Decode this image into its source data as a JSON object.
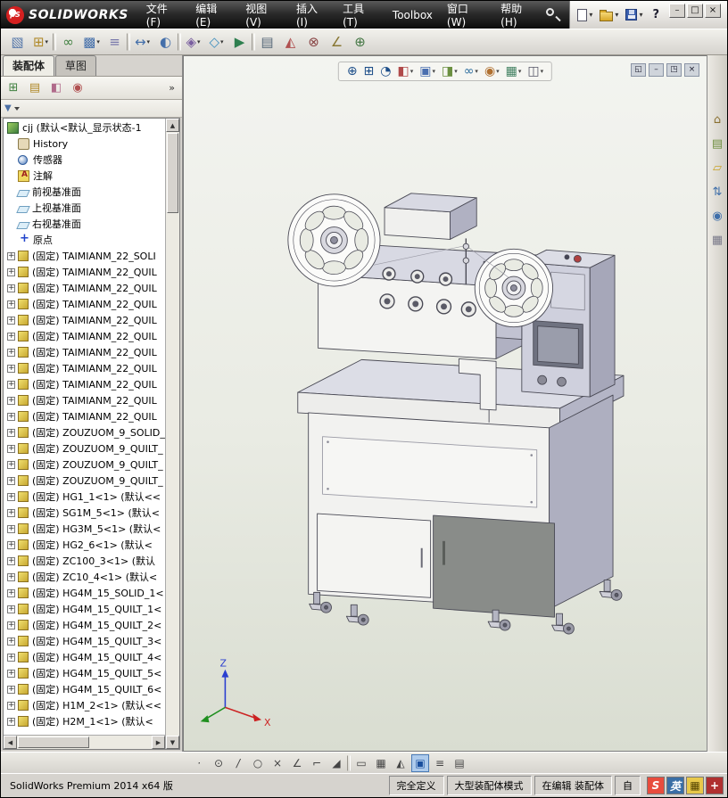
{
  "title_bar": {
    "logo_mark": "βS",
    "logo_text": "SOLIDWORKS",
    "menus": [
      "文件(F)",
      "编辑(E)",
      "视图(V)",
      "插入(I)",
      "工具(T)",
      "Toolbox",
      "窗口(W)",
      "帮助(H)"
    ],
    "quick_access": [
      {
        "name": "new-document-icon",
        "dropdown": true
      },
      {
        "name": "open-document-icon",
        "dropdown": true
      },
      {
        "name": "save-icon",
        "dropdown": true
      }
    ],
    "help_label": "?",
    "window_controls": [
      {
        "name": "minimize-button",
        "glyph": "–"
      },
      {
        "name": "maximize-button",
        "glyph": "□"
      },
      {
        "name": "close-button",
        "glyph": "×"
      }
    ]
  },
  "main_toolbar": {
    "items": [
      {
        "name": "edit-component-icon",
        "glyph": "▧",
        "color": "#5577aa"
      },
      {
        "name": "insert-components-icon",
        "glyph": "⊞",
        "color": "#b08a2a",
        "dropdown": true
      },
      {
        "type": "sep"
      },
      {
        "name": "mate-icon",
        "glyph": "∞",
        "color": "#3f7f3f"
      },
      {
        "name": "component-pattern-icon",
        "glyph": "▩",
        "color": "#446faa",
        "dropdown": true
      },
      {
        "name": "smart-fasteners-icon",
        "glyph": "≡",
        "color": "#7777aa"
      },
      {
        "type": "sep"
      },
      {
        "name": "move-component-icon",
        "glyph": "↔",
        "color": "#446faa",
        "dropdown": true
      },
      {
        "name": "show-hidden-components-icon",
        "glyph": "◐",
        "color": "#446faa"
      },
      {
        "type": "sep"
      },
      {
        "name": "assembly-features-icon",
        "glyph": "◈",
        "color": "#7a5fa0",
        "dropdown": true
      },
      {
        "name": "reference-geometry-icon",
        "glyph": "◇",
        "color": "#3f8fbf",
        "dropdown": true
      },
      {
        "name": "new-motion-study-icon",
        "glyph": "▶",
        "color": "#2e7f4f"
      },
      {
        "type": "sep"
      },
      {
        "name": "bill-of-materials-icon",
        "glyph": "▤",
        "color": "#556677"
      },
      {
        "name": "exploded-view-icon",
        "glyph": "◭",
        "color": "#b05050"
      },
      {
        "name": "interference-detection-icon",
        "glyph": "⊗",
        "color": "#884444"
      },
      {
        "name": "measure-icon",
        "glyph": "∠",
        "color": "#887733"
      },
      {
        "name": "mass-properties-icon",
        "glyph": "⊕",
        "color": "#447744"
      }
    ]
  },
  "left_panel": {
    "doc_tabs": [
      {
        "name": "tab-assembly",
        "label": "装配体",
        "active": true
      },
      {
        "name": "tab-sketch",
        "label": "草图",
        "active": false
      }
    ],
    "manager_tabs": [
      {
        "name": "featuremanager-tab-icon",
        "glyph": "⊞",
        "color": "#3f7f3f"
      },
      {
        "name": "propertymanager-tab-icon",
        "glyph": "▤",
        "color": "#b08a2a"
      },
      {
        "name": "configurationmanager-tab-icon",
        "glyph": "◧",
        "color": "#b06a8a"
      },
      {
        "name": "displaymanager-tab-icon",
        "glyph": "◉",
        "color": "#b05050"
      }
    ],
    "manager_more": "»",
    "filter": {
      "icon_glyph": "▼"
    },
    "tree": [
      {
        "type": "asm",
        "exp": "none",
        "label": "cjj (默认<默认_显示状态-1"
      },
      {
        "type": "history",
        "exp": "none",
        "label": "History"
      },
      {
        "type": "sensor",
        "exp": "none",
        "label": "传感器"
      },
      {
        "type": "ann",
        "exp": "none",
        "label": "注解"
      },
      {
        "type": "plane",
        "exp": "none",
        "label": "前视基准面"
      },
      {
        "type": "plane",
        "exp": "none",
        "label": "上视基准面"
      },
      {
        "type": "plane",
        "exp": "none",
        "label": "右视基准面"
      },
      {
        "type": "origin",
        "exp": "none",
        "label": "原点"
      },
      {
        "type": "part",
        "exp": "plus",
        "label": "(固定) TAIMIANM_22_SOLI"
      },
      {
        "type": "part",
        "exp": "plus",
        "label": "(固定) TAIMIANM_22_QUIL"
      },
      {
        "type": "part",
        "exp": "plus",
        "label": "(固定) TAIMIANM_22_QUIL"
      },
      {
        "type": "part",
        "exp": "plus",
        "label": "(固定) TAIMIANM_22_QUIL"
      },
      {
        "type": "part",
        "exp": "plus",
        "label": "(固定) TAIMIANM_22_QUIL"
      },
      {
        "type": "part",
        "exp": "plus",
        "label": "(固定) TAIMIANM_22_QUIL"
      },
      {
        "type": "part",
        "exp": "plus",
        "label": "(固定) TAIMIANM_22_QUIL"
      },
      {
        "type": "part",
        "exp": "plus",
        "label": "(固定) TAIMIANM_22_QUIL"
      },
      {
        "type": "part",
        "exp": "plus",
        "label": "(固定) TAIMIANM_22_QUIL"
      },
      {
        "type": "part",
        "exp": "plus",
        "label": "(固定) TAIMIANM_22_QUIL"
      },
      {
        "type": "part",
        "exp": "plus",
        "label": "(固定) TAIMIANM_22_QUIL"
      },
      {
        "type": "part",
        "exp": "plus",
        "label": "(固定) ZOUZUOM_9_SOLID_"
      },
      {
        "type": "part",
        "exp": "plus",
        "label": "(固定) ZOUZUOM_9_QUILT_"
      },
      {
        "type": "part",
        "exp": "plus",
        "label": "(固定) ZOUZUOM_9_QUILT_"
      },
      {
        "type": "part",
        "exp": "plus",
        "label": "(固定) ZOUZUOM_9_QUILT_"
      },
      {
        "type": "part",
        "exp": "plus",
        "label": "(固定) HG1_1<1> (默认<<"
      },
      {
        "type": "part",
        "exp": "plus",
        "label": "(固定) SG1M_5<1> (默认<"
      },
      {
        "type": "part",
        "exp": "plus",
        "label": "(固定) HG3M_5<1> (默认<"
      },
      {
        "type": "part",
        "exp": "plus",
        "label": "(固定) HG2_6<1> (默认<"
      },
      {
        "type": "part",
        "exp": "plus",
        "label": "(固定) ZC100_3<1> (默认"
      },
      {
        "type": "part",
        "exp": "plus",
        "label": "(固定) ZC10_4<1> (默认<"
      },
      {
        "type": "part",
        "exp": "plus",
        "label": "(固定) HG4M_15_SOLID_1<"
      },
      {
        "type": "part",
        "exp": "plus",
        "label": "(固定) HG4M_15_QUILT_1<"
      },
      {
        "type": "part",
        "exp": "plus",
        "label": "(固定) HG4M_15_QUILT_2<"
      },
      {
        "type": "part",
        "exp": "plus",
        "label": "(固定) HG4M_15_QUILT_3<"
      },
      {
        "type": "part",
        "exp": "plus",
        "label": "(固定) HG4M_15_QUILT_4<"
      },
      {
        "type": "part",
        "exp": "plus",
        "label": "(固定) HG4M_15_QUILT_5<"
      },
      {
        "type": "part",
        "exp": "plus",
        "label": "(固定) HG4M_15_QUILT_6<"
      },
      {
        "type": "part",
        "exp": "plus",
        "label": "(固定) H1M_2<1> (默认<<"
      },
      {
        "type": "part",
        "exp": "plus",
        "label": "(固定) H2M_1<1> (默认<"
      }
    ]
  },
  "viewport": {
    "heads_up": [
      {
        "name": "zoom-fit-icon",
        "glyph": "⊕",
        "color": "#1d4e89"
      },
      {
        "name": "zoom-area-icon",
        "glyph": "⊞",
        "color": "#1d4e89"
      },
      {
        "name": "previous-view-icon",
        "glyph": "◔",
        "color": "#1d4e89"
      },
      {
        "name": "section-view-icon",
        "glyph": "◧",
        "color": "#b04a4a",
        "dropdown": true
      },
      {
        "name": "view-orientation-icon",
        "glyph": "▣",
        "color": "#4a6fb0",
        "dropdown": true
      },
      {
        "name": "display-style-icon",
        "glyph": "◨",
        "color": "#6a8f3f",
        "dropdown": true
      },
      {
        "name": "hide-show-items-icon",
        "glyph": "∞",
        "color": "#2f6f9f",
        "dropdown": true
      },
      {
        "name": "edit-appearance-icon",
        "glyph": "◉",
        "color": "#b07030",
        "dropdown": true
      },
      {
        "name": "apply-scene-icon",
        "glyph": "▦",
        "color": "#3f7f5f",
        "dropdown": true
      },
      {
        "name": "view-settings-icon",
        "glyph": "◫",
        "color": "#555566",
        "dropdown": true
      }
    ],
    "doc_controls": [
      {
        "name": "doc-menu-icon",
        "glyph": "◱"
      },
      {
        "name": "doc-minimize-icon",
        "glyph": "–"
      },
      {
        "name": "doc-restore-icon",
        "glyph": "◳"
      },
      {
        "name": "doc-close-icon",
        "glyph": "×"
      }
    ],
    "triad": {
      "z": "Z",
      "x": "X"
    }
  },
  "task_pane": {
    "items": [
      {
        "name": "solidworks-resources-icon",
        "glyph": "⌂",
        "color": "#8a6f2f"
      },
      {
        "name": "design-library-icon",
        "glyph": "▤",
        "color": "#6f8f3f"
      },
      {
        "name": "file-explorer-icon",
        "glyph": "▱",
        "color": "#c9a227"
      },
      {
        "name": "search-results-icon",
        "glyph": "⇅",
        "color": "#3f6faa"
      },
      {
        "name": "appearances-icon",
        "glyph": "◉",
        "color": "#3f6faa"
      },
      {
        "name": "custom-properties-icon",
        "glyph": "▦",
        "color": "#7a7a8a"
      }
    ]
  },
  "snap_toolbar": {
    "items": [
      {
        "name": "snap-points-icon",
        "glyph": "·"
      },
      {
        "name": "snap-center-icon",
        "glyph": "⊙"
      },
      {
        "name": "snap-line-icon",
        "glyph": "/"
      },
      {
        "name": "snap-circle-icon",
        "glyph": "○"
      },
      {
        "name": "snap-intersection-icon",
        "glyph": "×"
      },
      {
        "name": "snap-angle-icon",
        "glyph": "∠"
      },
      {
        "name": "snap-perpendicular-icon",
        "glyph": "⌐"
      },
      {
        "name": "snap-tangent-icon",
        "glyph": "◢"
      },
      {
        "type": "sep"
      },
      {
        "name": "grid-system-icon",
        "glyph": "▭"
      },
      {
        "name": "grid-icon",
        "glyph": "▦"
      },
      {
        "name": "snap-inference-icon",
        "glyph": "◭"
      },
      {
        "name": "shaded-sketch-contours-icon",
        "glyph": "▣",
        "active": true,
        "color": "#1a4f9e"
      },
      {
        "name": "instant2d-icon",
        "glyph": "≡"
      },
      {
        "name": "instant3d-icon",
        "glyph": "▤"
      }
    ]
  },
  "status_bar": {
    "app_version": "SolidWorks Premium 2014 x64 版",
    "cells": [
      {
        "name": "status-constraint",
        "label": "完全定义"
      },
      {
        "name": "status-assembly-mode",
        "label": "大型装配体模式"
      },
      {
        "name": "status-editing",
        "label": "在编辑 装配体"
      },
      {
        "name": "status-custom",
        "label": "自"
      }
    ],
    "ime": [
      {
        "name": "sogou-icon",
        "glyph": "S",
        "bg": "#e84c3d",
        "color": "#ffffff"
      },
      {
        "name": "ime-language-icon",
        "glyph": "英",
        "bg": "#3a6ea5",
        "color": "#ffffff"
      },
      {
        "name": "ime-keyboard-icon",
        "glyph": "▦",
        "bg": "#e8c84a",
        "color": "#554400"
      },
      {
        "name": "ime-settings-icon",
        "glyph": "+",
        "bg": "#b03030",
        "color": "#ffffff"
      }
    ]
  }
}
